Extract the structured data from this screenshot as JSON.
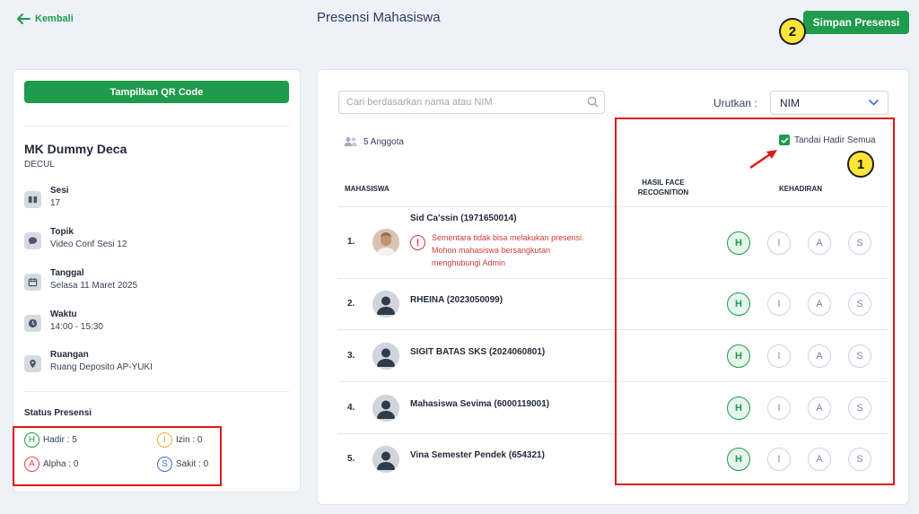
{
  "header": {
    "back_label": "Kembali",
    "title": "Presensi Mahasiswa",
    "save_label": "Simpan Presensi"
  },
  "badges": {
    "one": "1",
    "two": "2"
  },
  "left": {
    "qr_label": "Tampilkan QR Code",
    "course_name": "MK Dummy Deca",
    "course_code": "DECUL",
    "info": {
      "sesi_label": "Sesi",
      "sesi_value": "17",
      "topik_label": "Topik",
      "topik_value": "Video Conf Sesi 12",
      "tanggal_label": "Tanggal",
      "tanggal_value": "Selasa 11 Maret 2025",
      "waktu_label": "Waktu",
      "waktu_value": "14:00 - 15:30",
      "ruangan_label": "Ruangan",
      "ruangan_value": "Ruang Deposito AP-YUKI"
    },
    "status_title": "Status Presensi",
    "status": {
      "hadir": {
        "letter": "H",
        "text": "Hadir : 5"
      },
      "izin": {
        "letter": "I",
        "text": "Izin : 0"
      },
      "alpha": {
        "letter": "A",
        "text": "Alpha : 0"
      },
      "sakit": {
        "letter": "S",
        "text": "Sakit : 0"
      }
    }
  },
  "main": {
    "search_placeholder": "Cari berdasarkan nama atau NIM",
    "sort_label": "Urutkan :",
    "sort_value": "NIM",
    "members": "5 Anggota",
    "mark_all": "Tandai Hadir Semua",
    "col_student": "MAHASISWA",
    "col_face_1": "HASIL FACE",
    "col_face_2": "RECOGNITION",
    "col_attendance": "KEHADIRAN",
    "options": [
      "H",
      "I",
      "A",
      "S"
    ],
    "rows": [
      {
        "num": "1.",
        "name": "Sid Ca'ssin (1971650014)",
        "selected": "H"
      },
      {
        "num": "2.",
        "name": "RHEINA (2023050099)",
        "selected": "H"
      },
      {
        "num": "3.",
        "name": "SIGIT BATAS SKS (2024060801)",
        "selected": "H"
      },
      {
        "num": "4.",
        "name": "Mahasiswa Sevima (6000119001)",
        "selected": "H"
      },
      {
        "num": "5.",
        "name": "Vina Semester Pendek (654321)",
        "selected": "H"
      }
    ],
    "warning_lines": [
      "Sementara tidak bisa melakukan presensi.",
      "Mohon mahasiswa bersangkutan",
      "menghubungi Admin"
    ]
  },
  "colors": {
    "brand_green": "#1e9b4c",
    "highlight_red": "#e01717",
    "badge_yellow": "#fde53a",
    "warning_red": "#d23a3a"
  }
}
